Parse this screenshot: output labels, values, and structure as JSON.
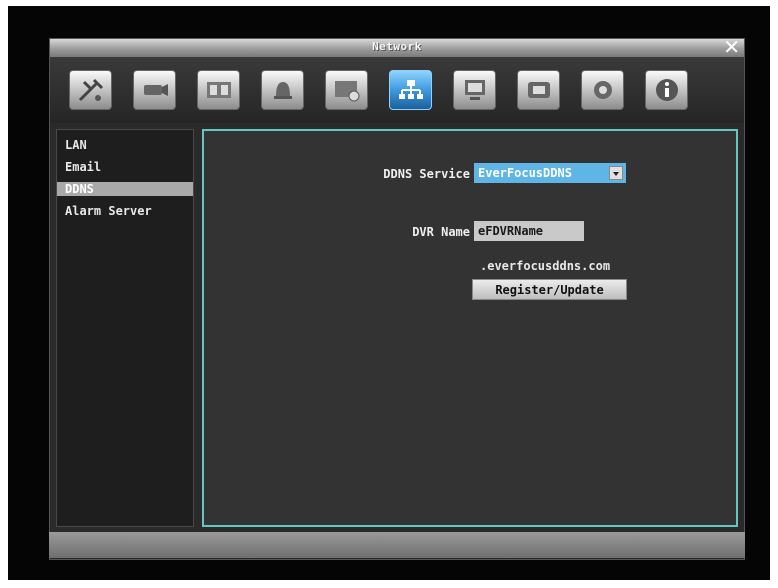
{
  "window": {
    "title": "Network",
    "close_label": "✕"
  },
  "toolbar": {
    "icons": [
      {
        "name": "quick-setup-icon"
      },
      {
        "name": "camera-icon"
      },
      {
        "name": "record-film-icon"
      },
      {
        "name": "alarm-bell-icon"
      },
      {
        "name": "schedule-icon"
      },
      {
        "name": "network-icon",
        "active": true
      },
      {
        "name": "display-icon"
      },
      {
        "name": "backup-icon"
      },
      {
        "name": "system-gear-icon"
      },
      {
        "name": "info-icon"
      }
    ]
  },
  "sidebar": {
    "items": [
      {
        "label": "LAN"
      },
      {
        "label": "Email"
      },
      {
        "label": "DDNS",
        "selected": true
      },
      {
        "label": "Alarm Server"
      }
    ]
  },
  "ddns": {
    "service_label": "DDNS Service",
    "service_value": "EverFocusDDNS",
    "dvr_name_label": "DVR Name",
    "dvr_name_value": "eFDVRName",
    "domain_suffix": ".everfocusddns.com",
    "register_button": "Register/Update"
  },
  "colors": {
    "panel_border": "#66c7c1",
    "select_bg": "#5fb5e6",
    "active_tool": "#3d9ae0"
  }
}
